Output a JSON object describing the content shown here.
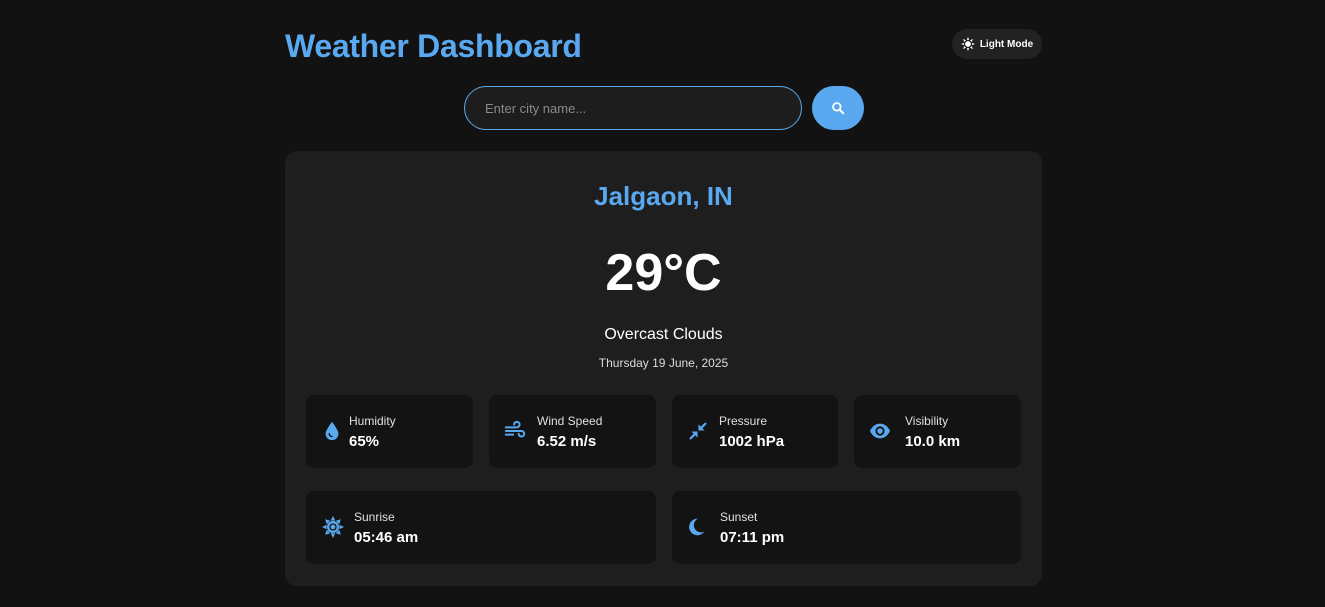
{
  "header": {
    "title": "Weather Dashboard",
    "mode_toggle_label": "Light Mode"
  },
  "search": {
    "placeholder": "Enter city name...",
    "value": ""
  },
  "weather": {
    "city": "Jalgaon, IN",
    "temperature": "29°C",
    "condition": "Overcast Clouds",
    "date": "Thursday 19 June, 2025"
  },
  "stats": {
    "humidity": {
      "label": "Humidity",
      "value": "65%",
      "icon": "droplet-icon"
    },
    "wind": {
      "label": "Wind Speed",
      "value": "6.52 m/s",
      "icon": "wind-icon"
    },
    "pressure": {
      "label": "Pressure",
      "value": "1002 hPa",
      "icon": "compress-icon"
    },
    "visibility": {
      "label": "Visibility",
      "value": "10.0 km",
      "icon": "eye-icon"
    },
    "sunrise": {
      "label": "Sunrise",
      "value": "05:46 am",
      "icon": "sun-icon"
    },
    "sunset": {
      "label": "Sunset",
      "value": "07:11 pm",
      "icon": "moon-icon"
    }
  },
  "colors": {
    "accent": "#5aa9f0",
    "background": "#121212",
    "card": "#1e1e1e",
    "tile": "#131313"
  }
}
